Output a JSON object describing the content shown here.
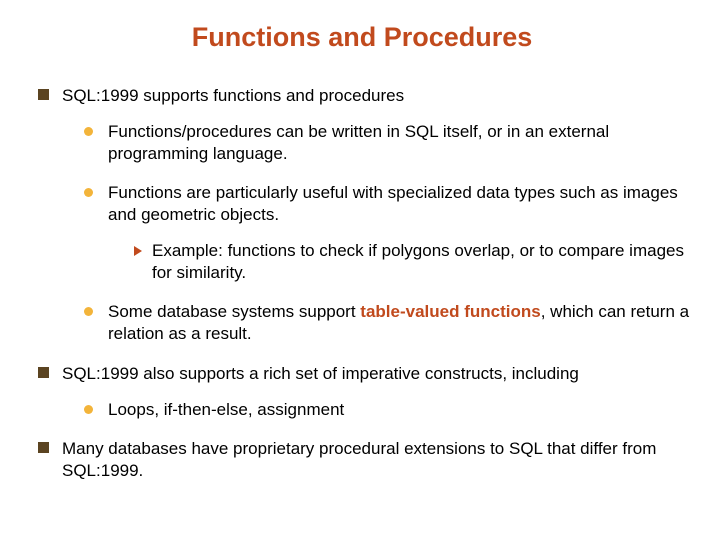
{
  "title": "Functions and Procedures",
  "b1": {
    "text": "SQL:1999 supports functions and procedures",
    "sub": {
      "a": "Functions/procedures can be written in SQL itself, or in an external programming language.",
      "b": "Functions are particularly useful with specialized data types such as images and geometric objects.",
      "b_ex": "Example: functions to check if polygons overlap, or to compare images for similarity.",
      "c_pre": "Some database systems support ",
      "c_em": "table-valued functions",
      "c_post": ", which can return a relation as a result."
    }
  },
  "b2": {
    "text": "SQL:1999 also supports a rich set of imperative constructs, including",
    "sub": {
      "a": "Loops, if-then-else, assignment"
    }
  },
  "b3": {
    "text": "Many databases have proprietary procedural extensions to SQL that differ from SQL:1999."
  }
}
